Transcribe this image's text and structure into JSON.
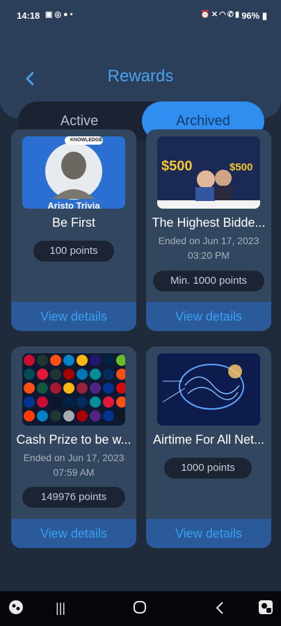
{
  "status_bar": {
    "time": "14:18",
    "battery": "96%",
    "left_icons": [
      "gallery-icon",
      "whatsapp-icon",
      "chat-icon",
      "dot-icon"
    ],
    "right_icons": [
      "alarm-icon",
      "mute-icon",
      "wifi-icon",
      "call-icon",
      "signal-icon",
      "battery-icon"
    ]
  },
  "header": {
    "title": "Rewards",
    "back_icon": "chevron-left-icon"
  },
  "tabs": [
    {
      "label": "Active",
      "selected": false
    },
    {
      "label": "Archived",
      "selected": true
    }
  ],
  "rewards": [
    {
      "name": "Be First",
      "ended": "",
      "points": "100 points",
      "button": "View details",
      "image": "aristo-trivia-logo",
      "image_text": "Aristo Trivia",
      "image_badge": "KNOWLEDGE"
    },
    {
      "name": "The Highest Bidde...",
      "ended": "Ended on Jun 17, 2023\n03:20 PM",
      "points": "Min. 1000 points",
      "button": "View details",
      "image": "bonus-banner",
      "image_text": "$500",
      "image_text_2": "$500"
    },
    {
      "name": "Cash Prize to be w...",
      "ended": "Ended on Jun 17, 2023\n07:59 AM",
      "points": "149976 points",
      "button": "View details",
      "image": "nfl-team-logos"
    },
    {
      "name": "Airtime For All Net...",
      "ended": "",
      "points": "1000 points",
      "button": "View details",
      "image": "digital-brain"
    }
  ],
  "navbar": [
    "bixby-icon",
    "recent-apps-icon",
    "home-icon",
    "back-icon",
    "accessibility-icon"
  ],
  "colors": {
    "accent": "#2f8ef0",
    "background": "#1f2a3b",
    "card": "#33465f",
    "button_bar": "#2a5a9a"
  }
}
